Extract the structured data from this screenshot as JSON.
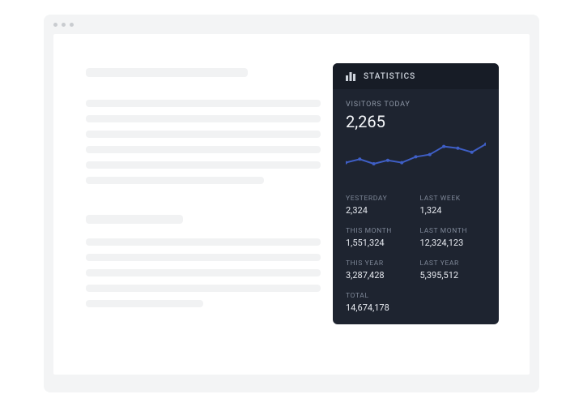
{
  "panel": {
    "header": "STATISTICS",
    "today_label": "VISITORS TODAY",
    "today_value": "2,265",
    "stats": [
      {
        "label": "YESTERDAY",
        "value": "2,324"
      },
      {
        "label": "LAST WEEK",
        "value": "1,324"
      },
      {
        "label": "THIS MONTH",
        "value": "1,551,324"
      },
      {
        "label": "LAST MONTH",
        "value": "12,324,123"
      },
      {
        "label": "THIS YEAR",
        "value": "3,287,428"
      },
      {
        "label": "LAST YEAR",
        "value": "5,395,512"
      },
      {
        "label": "TOTAL",
        "value": "14,674,178"
      }
    ]
  },
  "chart_data": {
    "type": "line",
    "x": [
      0,
      1,
      2,
      3,
      4,
      5,
      6,
      7,
      8,
      9,
      10
    ],
    "values": [
      30,
      36,
      28,
      34,
      30,
      40,
      44,
      58,
      55,
      48,
      62
    ],
    "y_range": [
      0,
      70
    ],
    "stroke": "#3f5fc6"
  }
}
